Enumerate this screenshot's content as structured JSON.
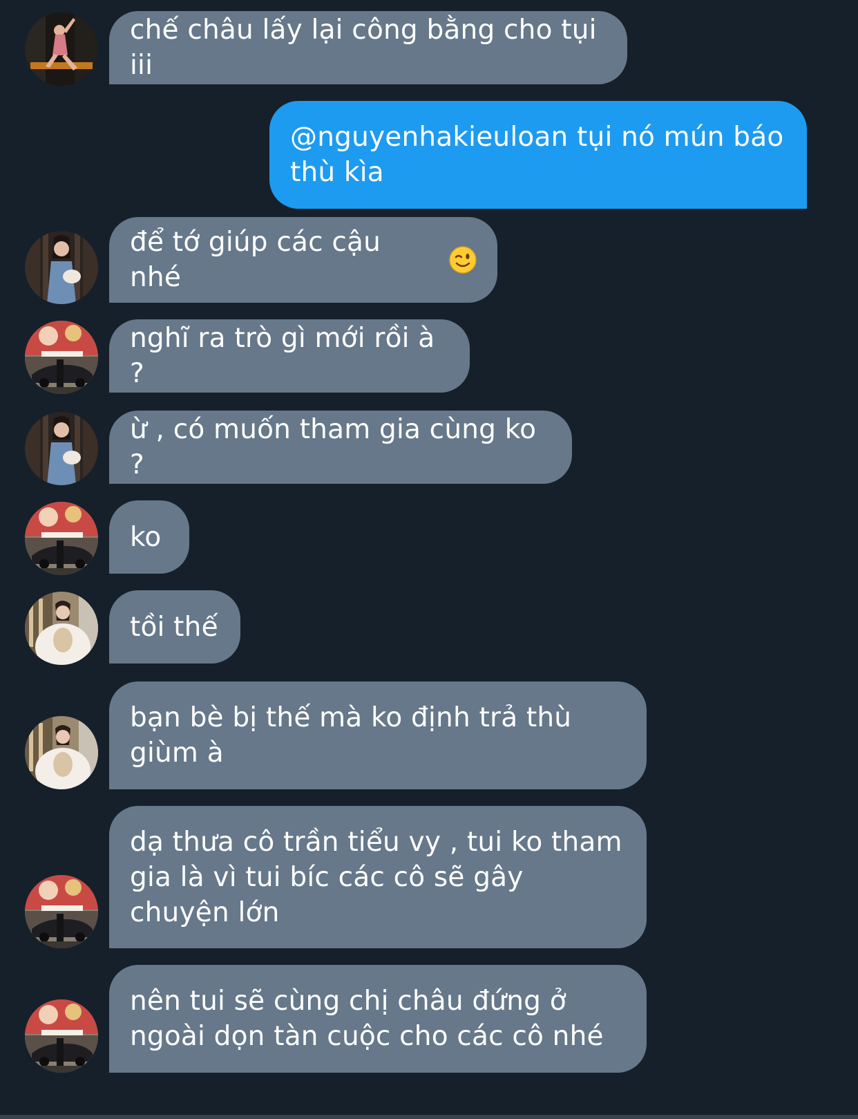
{
  "messages": [
    {
      "sender": "incoming",
      "avatar": "avatar-pink-outfit",
      "text": "chế châu lấy lại công bằng cho tụi iii"
    },
    {
      "sender": "outgoing",
      "text": "@nguyenhakieuloan tụi nó mún báo thù kìa"
    },
    {
      "sender": "incoming",
      "avatar": "avatar-denim-dress",
      "text": "để tớ giúp các cậu nhé",
      "emoji": "winking-face-emoji"
    },
    {
      "sender": "incoming",
      "avatar": "avatar-car-street",
      "text": "nghĩ ra trò gì mới rồi à ?"
    },
    {
      "sender": "incoming",
      "avatar": "avatar-denim-dress",
      "text": "ừ , có muốn tham gia cùng ko ?"
    },
    {
      "sender": "incoming",
      "avatar": "avatar-car-street",
      "text": "ko"
    },
    {
      "sender": "incoming",
      "avatar": "avatar-white-fur",
      "text": "tồi thế"
    },
    {
      "sender": "incoming",
      "avatar": "avatar-white-fur",
      "text": "bạn bè bị thế mà ko định trả thù giùm à"
    },
    {
      "sender": "incoming",
      "avatar": "avatar-car-street",
      "text": "dạ thưa cô trần tiểu vy , tui ko tham gia là vì tui bíc các cô sẽ gây chuyện lớn"
    },
    {
      "sender": "incoming",
      "avatar": "avatar-car-street",
      "text": "nên tui sẽ cùng chị châu đứng ở ngoài dọn tàn cuộc cho các cô nhé"
    }
  ],
  "colors": {
    "background": "#15202b",
    "incoming_bubble": "#66788a",
    "outgoing_bubble": "#1d9bf0",
    "text": "#ffffff"
  }
}
